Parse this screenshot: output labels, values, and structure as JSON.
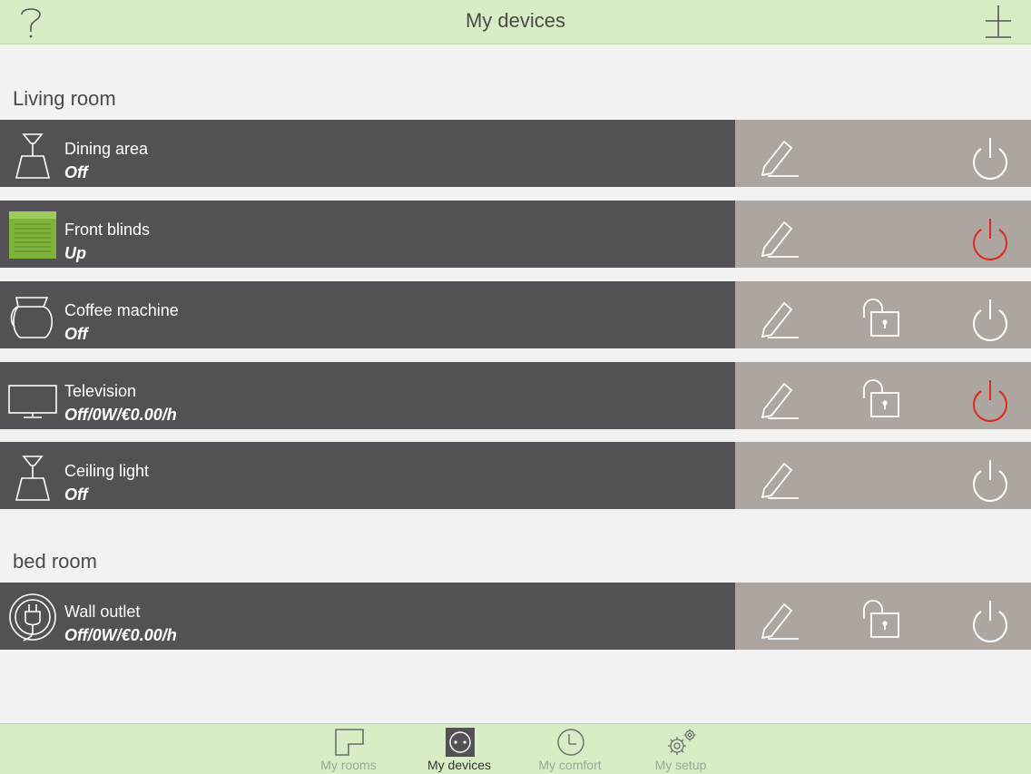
{
  "header": {
    "title": "My devices",
    "help_icon": "question-icon",
    "add_icon": "plus-icon"
  },
  "sections": [
    {
      "title": "Living room"
    },
    {
      "title": "bed room"
    }
  ],
  "devices": [
    {
      "name": "Dining area",
      "state": "Off",
      "icon": "pendant-lamp-icon",
      "lock": false,
      "power_active": false
    },
    {
      "name": "Front blinds",
      "state": "Up",
      "icon": "blinds-icon",
      "lock": false,
      "power_active": true
    },
    {
      "name": "Coffee machine",
      "state": "Off",
      "icon": "coffee-pot-icon",
      "lock": true,
      "power_active": false
    },
    {
      "name": "Television",
      "state": "Off/0W/€0.00/h",
      "icon": "tv-icon",
      "lock": true,
      "power_active": true
    },
    {
      "name": "Ceiling light",
      "state": "Off",
      "icon": "pendant-lamp-icon",
      "lock": false,
      "power_active": false
    },
    {
      "name": "Wall outlet",
      "state": "Off/0W/€0.00/h",
      "icon": "plug-icon",
      "lock": true,
      "power_active": false
    }
  ],
  "tabs": [
    {
      "label": "My rooms",
      "icon": "rooms-icon",
      "active": false
    },
    {
      "label": "My devices",
      "icon": "outlet-icon",
      "active": true
    },
    {
      "label": "My comfort",
      "icon": "clock-icon",
      "active": false
    },
    {
      "label": "My setup",
      "icon": "gears-icon",
      "active": false
    }
  ],
  "colors": {
    "header_bg": "#d8ecc5",
    "row_bg": "#535155",
    "action_bg": "#aca5a0",
    "power_on": "#e0281e",
    "blinds_green": "#7fb23a"
  }
}
